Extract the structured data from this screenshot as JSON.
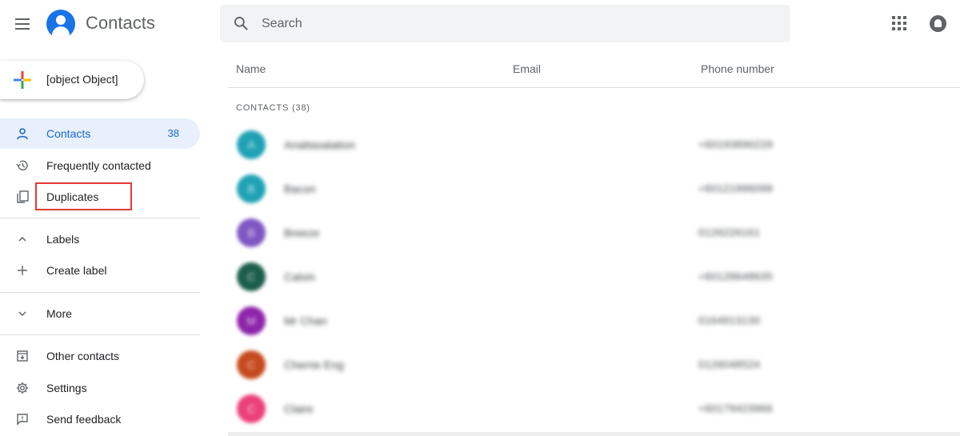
{
  "header": {
    "app_title": "Contacts",
    "search_placeholder": "Search",
    "brand_color": "#1a73e8"
  },
  "sidebar": {
    "create_label": {
      "label": "Create label",
      "icon": "plus-icon"
    },
    "items": [
      {
        "label": "Contacts",
        "count": "38",
        "icon": "person-icon",
        "active": true
      },
      {
        "label": "Frequently contacted",
        "icon": "history-icon"
      },
      {
        "label": "Duplicates",
        "icon": "copy-icon",
        "highlighted": true
      }
    ],
    "labels_group": {
      "label": "Labels",
      "icon": "chevron-up-icon"
    },
    "more": {
      "label": "More",
      "icon": "chevron-down-icon"
    },
    "bottom_items": [
      {
        "label": "Other contacts",
        "icon": "archive-icon"
      },
      {
        "label": "Settings",
        "icon": "gear-icon"
      },
      {
        "label": "Send feedback",
        "icon": "feedback-icon"
      }
    ]
  },
  "main": {
    "columns": [
      "Name",
      "Email",
      "Phone number"
    ],
    "section_label": "CONTACTS (38)",
    "contacts": [
      {
        "initial": "A",
        "name": "Anattasalation",
        "phone": "+60193896229",
        "color": "#1fa2b4"
      },
      {
        "initial": "B",
        "name": "Bacon",
        "phone": "+60121996099",
        "color": "#1fa2b4"
      },
      {
        "initial": "B",
        "name": "Breeze",
        "phone": "0126226161",
        "color": "#7e57c2"
      },
      {
        "initial": "C",
        "name": "Calvin",
        "phone": "+60128648635",
        "color": "#1b5e4a"
      },
      {
        "initial": "M",
        "name": "Mr Chan",
        "phone": "0164913130",
        "color": "#8e24aa"
      },
      {
        "initial": "C",
        "name": "Cherrie Eng",
        "phone": "0126048524",
        "color": "#c64a1e"
      },
      {
        "initial": "C",
        "name": "Claire",
        "phone": "+60179423966",
        "color": "#ec407a"
      }
    ]
  }
}
